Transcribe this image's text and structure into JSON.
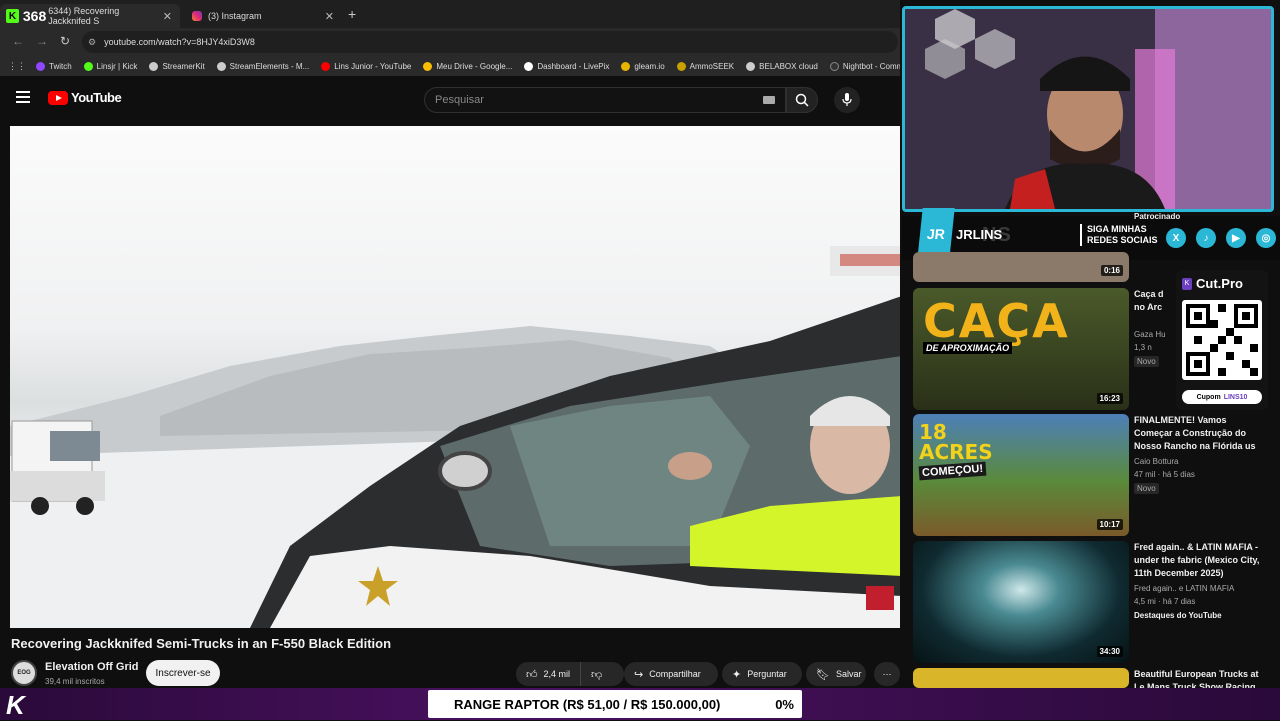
{
  "browser": {
    "tabs": [
      {
        "label": "6344) Recovering Jackknifed S",
        "count": "368",
        "icon": "kick-icon",
        "active": true
      },
      {
        "label": "(3) Instagram",
        "icon": "instagram-icon",
        "active": false
      }
    ],
    "url": "youtube.com/watch?v=8HJY4xiD3W8",
    "bookmarks": [
      {
        "label": "Twitch",
        "color": "#9146ff"
      },
      {
        "label": "Linsjr | Kick",
        "color": "#53fc18"
      },
      {
        "label": "StreamerKit",
        "color": "#cccccc"
      },
      {
        "label": "StreamElements - M...",
        "color": "#cccccc"
      },
      {
        "label": "Lins Junior - YouTube",
        "color": "#ff0000"
      },
      {
        "label": "Meu Drive - Google...",
        "color": "#fbbc04"
      },
      {
        "label": "Dashboard - LivePix",
        "color": "#ffffff"
      },
      {
        "label": "gleam.io",
        "color": "#e8b400"
      },
      {
        "label": "AmmoSEEK",
        "color": "#c8a000"
      },
      {
        "label": "BELABOX cloud",
        "color": "#cccccc"
      },
      {
        "label": "Nightbot - Comm",
        "color": "#333333"
      }
    ]
  },
  "youtube": {
    "logo_text": "YouTube",
    "search_placeholder": "Pesquisar"
  },
  "video": {
    "title": "Recovering Jackknifed Semi-Trucks in an F-550 Black Edition",
    "channel": "Elevation Off Grid",
    "subscribers": "39,4 mil inscritos",
    "subscribe_label": "Inscrever-se",
    "likes": "2,4 mil",
    "share_label": "Compartilhar",
    "ask_label": "Perguntar",
    "save_label": "Salvar"
  },
  "overlay": {
    "streamer_name": "JRLINS",
    "streamer_name_ghost": "NS",
    "follow_text_1": "SIGA MINHAS",
    "follow_text_2": "REDES SOCIAIS",
    "sponsor_label": "Patrocinado",
    "cut_pro": "Cut.Pro",
    "coupon_label": "Cupom",
    "coupon_code": "LINS10",
    "goal_text": "RANGE RAPTOR (R$ 51,00 / R$ 150.000,00)",
    "goal_percent": "0%"
  },
  "recommendations": [
    {
      "title": "",
      "duration": "0:16",
      "meta1": "",
      "meta2": "",
      "badge": ""
    },
    {
      "title": "Caça d no Arc",
      "duration": "16:23",
      "meta1": "Gaza Hu",
      "meta2": "1,3 n",
      "badge": "Novo",
      "thumb_text": "CAÇA",
      "thumb_sub": "DE APROXIMAÇÃO"
    },
    {
      "title": "FINALMENTE! Vamos Começar a Construção do Nosso Rancho na Flórida us",
      "duration": "10:17",
      "meta1": "Caio Bottura",
      "meta2": "47 mil · há 5 dias",
      "badge": "Novo",
      "thumb_text": "18 ACRES",
      "thumb_sub": "COMEÇOU!"
    },
    {
      "title": "Fred again.. & LATIN MAFIA - under the fabric (Mexico City, 11th December 2025)",
      "duration": "34:30",
      "meta1": "Fred again.. e LATIN MAFIA",
      "meta2": "4,5 mi · há 7 dias",
      "badge": "Destaques do YouTube"
    },
    {
      "title": "Beautiful European Trucks at Le Mans Truck Show Racing",
      "duration": "",
      "meta1": "",
      "meta2": "",
      "badge": ""
    }
  ]
}
